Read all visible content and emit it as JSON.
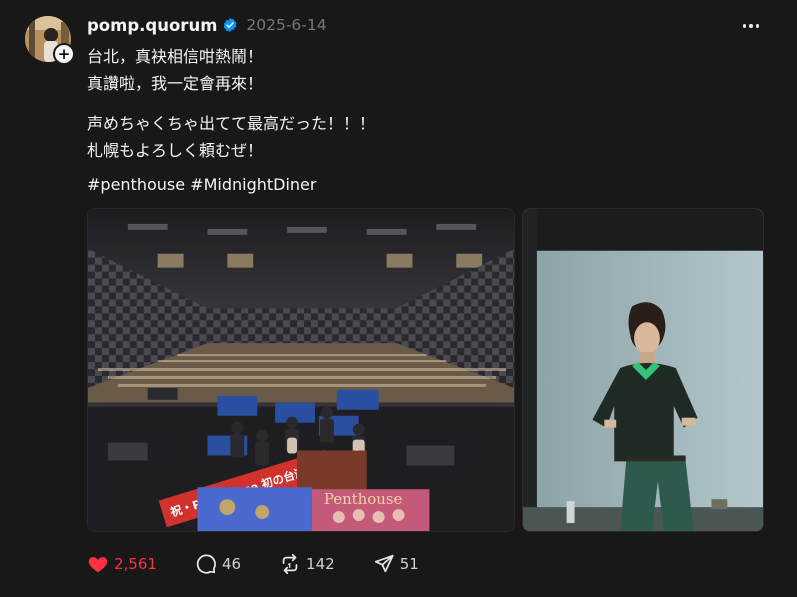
{
  "post": {
    "username": "pomp.quorum",
    "date": "2025-6-14",
    "verified_icon": "verified-badge-icon",
    "follow_icon": "plus-icon",
    "text_lines": [
      "台北，真袂相信咁熱鬧！",
      "真讚啦，我一定會再來！",
      "声めちゃくちゃ出てて最高だった！！！",
      "札幌もよろしく頼むぜ！"
    ],
    "hashtags": [
      "#penthouse",
      "#MidnightDiner"
    ],
    "images": [
      {
        "name": "concert-stage-photo",
        "banner_text": "祝・Penthouse 初の台湾公演ライブ",
        "poster_text": "Penthouse"
      },
      {
        "name": "portrait-photo"
      }
    ],
    "stats": {
      "likes": "2,561",
      "comments": "46",
      "reposts": "142",
      "shares": "51"
    },
    "colors": {
      "background": "#181818",
      "like_red": "#ff3040",
      "verified_blue": "#0095f6",
      "muted": "#777777"
    }
  }
}
